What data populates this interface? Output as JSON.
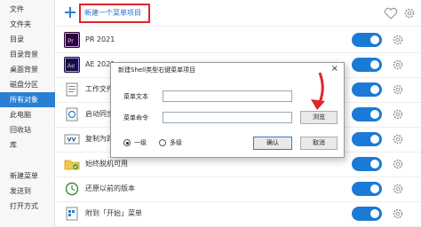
{
  "sidebar": {
    "items": [
      {
        "label": "文件"
      },
      {
        "label": "文件夹"
      },
      {
        "label": "目录"
      },
      {
        "label": "目录背景"
      },
      {
        "label": "桌面背景"
      },
      {
        "label": "磁盘分区"
      },
      {
        "label": "所有对象"
      },
      {
        "label": "此电脑"
      },
      {
        "label": "回收站"
      },
      {
        "label": "库"
      },
      {
        "label": "新建菜单"
      },
      {
        "label": "发送到"
      },
      {
        "label": "打开方式"
      }
    ],
    "active_index": 6
  },
  "top": {
    "new_item_label": "新建一个菜单项目"
  },
  "rows": [
    {
      "label": "PR 2021",
      "icon": "premiere-icon",
      "enabled": true
    },
    {
      "label": "AE 2021",
      "icon": "after-effects-icon",
      "enabled": true
    },
    {
      "label": "工作文件",
      "icon": "folder-doc-icon",
      "enabled": true
    },
    {
      "label": "启动同步",
      "icon": "sync-icon",
      "enabled": true
    },
    {
      "label": "复制为路",
      "icon": "copy-path-icon",
      "enabled": true
    },
    {
      "label": "始终脱机可用",
      "icon": "offline-folder-icon",
      "enabled": true
    },
    {
      "label": "还原以前的版本",
      "icon": "restore-icon",
      "enabled": true
    },
    {
      "label": "附到「开始」菜单",
      "icon": "pin-start-icon",
      "enabled": true
    }
  ],
  "dialog": {
    "title": "新建Shell类型右键菜单项目",
    "close_glyph": "×",
    "text_label": "菜单文本",
    "text_value": "",
    "command_label": "菜单命令",
    "command_value": "",
    "browse_label": "浏览",
    "radio_level1": "一级",
    "radio_multi": "多级",
    "ok_label": "确认",
    "cancel_label": "取消"
  },
  "colors": {
    "accent": "#2a7fd4",
    "toggle_on": "#1b7ad6",
    "highlight_box": "#e0252b"
  }
}
